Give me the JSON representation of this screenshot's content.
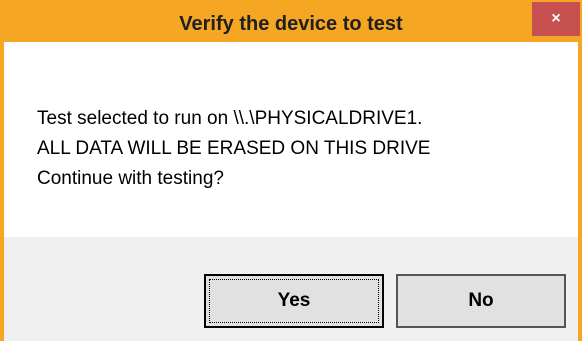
{
  "dialog": {
    "title": "Verify the device to test",
    "close_label": "×",
    "message_lines": [
      "Test selected to run on \\\\.\\PHYSICALDRIVE1.",
      "ALL DATA WILL BE ERASED ON THIS DRIVE",
      "Continue with testing?"
    ],
    "yes_label": "Yes",
    "no_label": "No"
  },
  "colors": {
    "titlebar": "#f5a623",
    "close_button": "#c75050",
    "content_background": "#ffffff",
    "button_area_background": "#f0f0f0"
  }
}
